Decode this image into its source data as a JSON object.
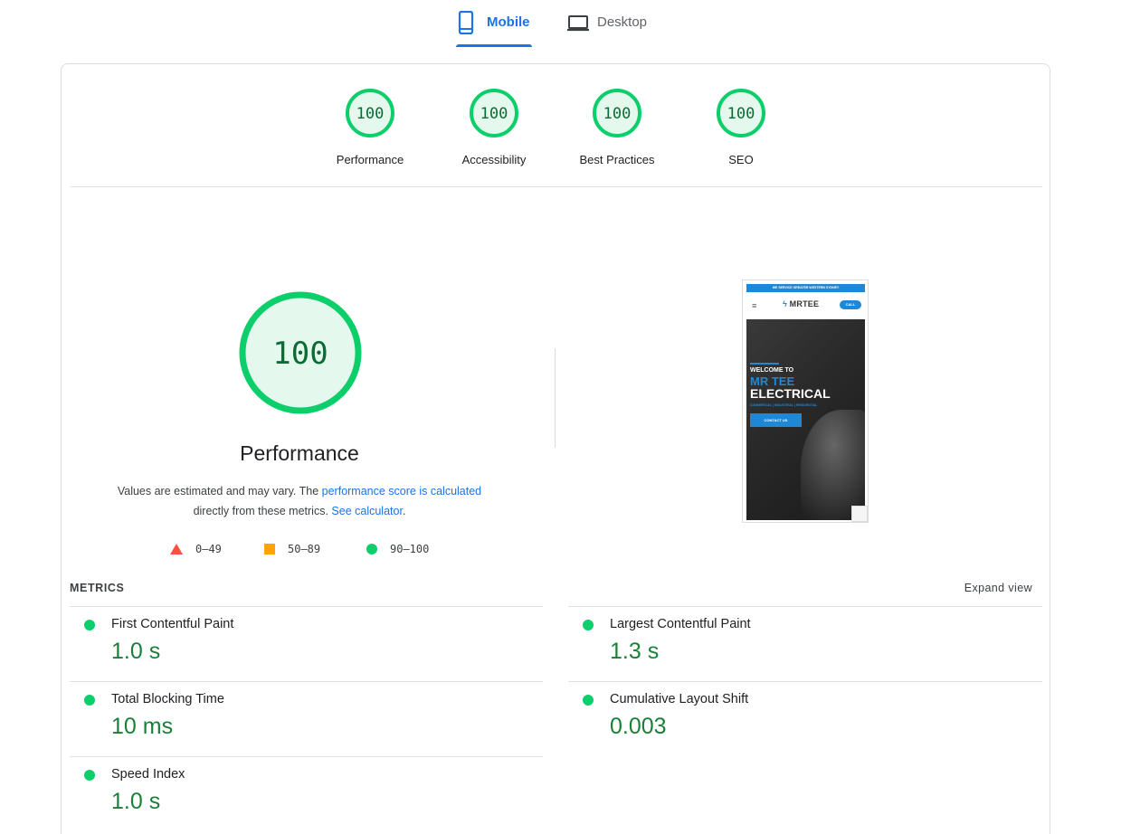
{
  "tabs": [
    {
      "label": "Mobile",
      "icon": "smartphone-icon",
      "active": true
    },
    {
      "label": "Desktop",
      "icon": "laptop-icon",
      "active": false
    }
  ],
  "categories": [
    {
      "score": "100",
      "label": "Performance"
    },
    {
      "score": "100",
      "label": "Accessibility"
    },
    {
      "score": "100",
      "label": "Best Practices"
    },
    {
      "score": "100",
      "label": "SEO"
    }
  ],
  "performance": {
    "score": "100",
    "title": "Performance",
    "desc_prefix": "Values are estimated and may vary. The ",
    "desc_link1": "performance score is calculated",
    "desc_middle": " directly from these metrics. ",
    "desc_link2": "See calculator",
    "desc_suffix": "."
  },
  "legend": [
    {
      "range": "0–49",
      "shape": "triangle",
      "color": "#ff4e42"
    },
    {
      "range": "50–89",
      "shape": "square",
      "color": "#ffa400"
    },
    {
      "range": "90–100",
      "shape": "circle",
      "color": "#0cce6b"
    }
  ],
  "screenshot": {
    "banner": "WE SERVICE GREATER WESTERN SYDNEY",
    "logo": "MRTEE",
    "call": "CALL",
    "welcome": "WELCOME TO",
    "brand1": "MR TEE",
    "brand2": "ELECTRICAL",
    "subtitle": "COMMERCIAL | INDUSTRIAL | RESIDENTIAL",
    "cta": "CONTACT US"
  },
  "metrics_section": {
    "title": "METRICS",
    "expand_label": "Expand view"
  },
  "metrics": [
    {
      "name": "First Contentful Paint",
      "value": "1.0 s"
    },
    {
      "name": "Largest Contentful Paint",
      "value": "1.3 s"
    },
    {
      "name": "Total Blocking Time",
      "value": "10 ms"
    },
    {
      "name": "Cumulative Layout Shift",
      "value": "0.003"
    },
    {
      "name": "Speed Index",
      "value": "1.0 s"
    }
  ],
  "colors": {
    "accent": "#1a73e8",
    "pass": "#0cce6b",
    "pass_text": "#188038",
    "gauge_fill": "#e5f8ee"
  }
}
